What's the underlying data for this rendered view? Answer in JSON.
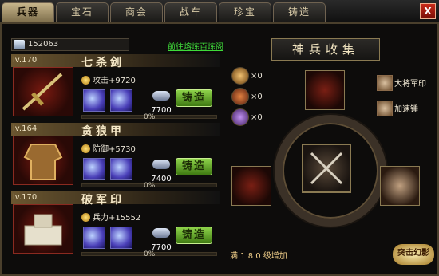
{
  "tabs": [
    {
      "label": "兵器",
      "active": true
    },
    {
      "label": "宝石"
    },
    {
      "label": "商会"
    },
    {
      "label": "战车"
    },
    {
      "label": "珍宝"
    },
    {
      "label": "铸造"
    }
  ],
  "close_label": "X",
  "silver": "152063",
  "link_text": "前往熔炼百炼阁",
  "items": [
    {
      "level": "lv.170",
      "name": "七杀剑",
      "stat": "攻击+9720",
      "ore": "7700",
      "forge_label": "铸造",
      "progress": "0%"
    },
    {
      "level": "lv.164",
      "name": "贪狼甲",
      "stat": "防御+5730",
      "ore": "7400",
      "forge_label": "铸造",
      "progress": "0%"
    },
    {
      "level": "lv.170",
      "name": "破军印",
      "stat": "兵力+15552",
      "ore": "7700",
      "forge_label": "铸造",
      "progress": "0%"
    }
  ],
  "right": {
    "banner": "神兵收集",
    "hammers": [
      {
        "count": "×0"
      },
      {
        "count": "×0"
      },
      {
        "count": "×0"
      }
    ],
    "side_items": [
      "大将军印",
      "加速锤"
    ],
    "bottom_text": "满 1 8 0 级增加",
    "bottom_badge": "突击幻影"
  },
  "colors": {
    "accent": "#8ed34a",
    "gold": "#f2d08a",
    "red": "#7a1f14"
  }
}
